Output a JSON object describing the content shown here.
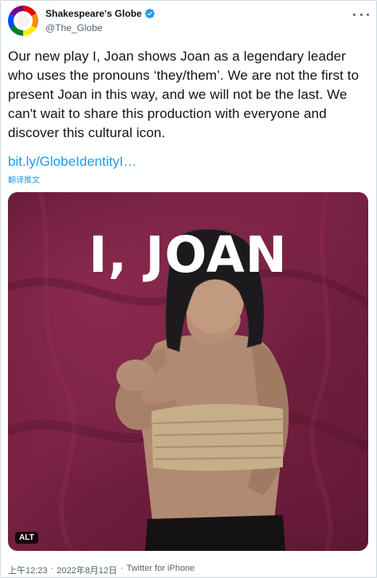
{
  "author": {
    "display_name": "Shakespeare's Globe",
    "handle": "@The_Globe",
    "avatar_icon": "pride-ring-avatar",
    "verified_icon": "verified-badge-icon",
    "verified_color": "#1d9bf0"
  },
  "tweet": {
    "text": "Our new play I, Joan shows Joan as a legendary leader who uses the pronouns ‘they/them’. We are not the first to present Joan in this way, and we will not be the last. We can't wait to share this production with everyone and discover this cultural icon.",
    "link": "bit.ly/GlobeIdentityI…",
    "translate_label": "翻译推文"
  },
  "media": {
    "poster_title": "I, JOAN",
    "alt_label": "ALT"
  },
  "meta": {
    "time": "上午12:23",
    "separator": "·",
    "date": "2022年8月12日",
    "separator2": "·",
    "source": "Twitter for iPhone"
  },
  "colors": {
    "link": "#1d9bf0",
    "secondary_text": "#536471",
    "background_maroon": "#6e1d3c"
  }
}
